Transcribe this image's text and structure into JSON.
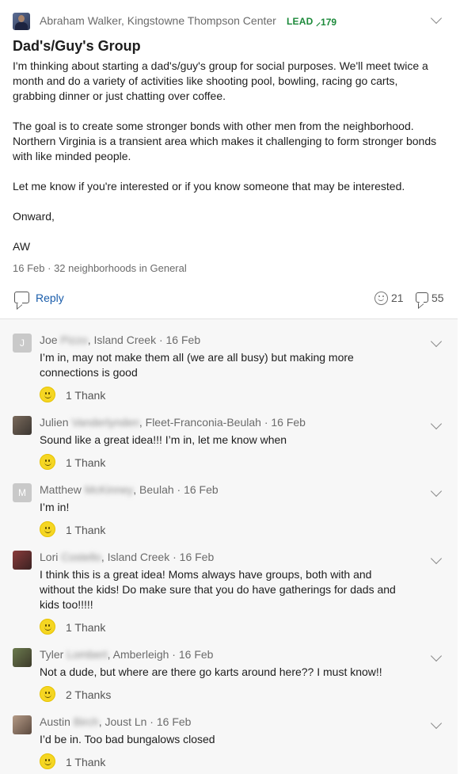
{
  "post": {
    "author": "Abraham Walker, Kingstowne Thompson Center",
    "badge": "LEAD",
    "badge_score": "179",
    "title": "Dad's/Guy's Group",
    "paragraphs": [
      "I'm thinking about starting a dad's/guy's group for social purposes. We'll meet twice a month and do a variety of activities like shooting pool, bowling, racing go carts, grabbing dinner or just chatting over coffee.",
      "The goal is to create some stronger bonds with other men from the neighborhood. Northern Virginia is a transient area which makes it challenging to form stronger bonds with like minded people.",
      "Let me know if you're interested or if you know someone that may be interested.",
      "Onward,",
      "AW"
    ],
    "date": "16 Feb",
    "audience": "32 neighborhoods in General",
    "reply_label": "Reply",
    "reaction_count": "21",
    "comment_count": "55"
  },
  "comments": [
    {
      "first": "Joe",
      "last": "Pizzo",
      "location": ", Island Creek · 16 Feb",
      "text": "I’m in, may not make them all (we are all busy) but making more connections is good",
      "thanks": "1 Thank",
      "avatar_letter": "J"
    },
    {
      "first": "Julien",
      "last": "Vanderlynden",
      "location": ", Fleet-Franconia-Beulah · 16 Feb",
      "text": "Sound like a great idea!!! I’m in, let me know when",
      "thanks": "1 Thank",
      "avatar_letter": ""
    },
    {
      "first": "Matthew",
      "last": "McKinney",
      "location": ", Beulah · 16 Feb",
      "text": "I’m in!",
      "thanks": "1 Thank",
      "avatar_letter": "M"
    },
    {
      "first": "Lori",
      "last": "Costello",
      "location": ", Island Creek · 16 Feb",
      "text": "I think this is a great idea! Moms always have groups, both with and without the kids! Do make sure that you do have gatherings for dads and kids too!!!!!",
      "thanks": "1 Thank",
      "avatar_letter": ""
    },
    {
      "first": "Tyler",
      "last": "Lombert",
      "location": ", Amberleigh · 16 Feb",
      "text": "Not a dude, but where are there go karts around here?? I must know!!",
      "thanks": "2 Thanks",
      "avatar_letter": ""
    },
    {
      "first": "Austin",
      "last": "Birch",
      "location": ", Joust Ln · 16 Feb",
      "text": "I’d be in. Too bad bungalows closed",
      "thanks": "1 Thank",
      "avatar_letter": ""
    }
  ],
  "colors": {
    "link": "#1a5dab",
    "lead_green": "#1d8a3b",
    "thank_yellow": "#f5d623"
  }
}
